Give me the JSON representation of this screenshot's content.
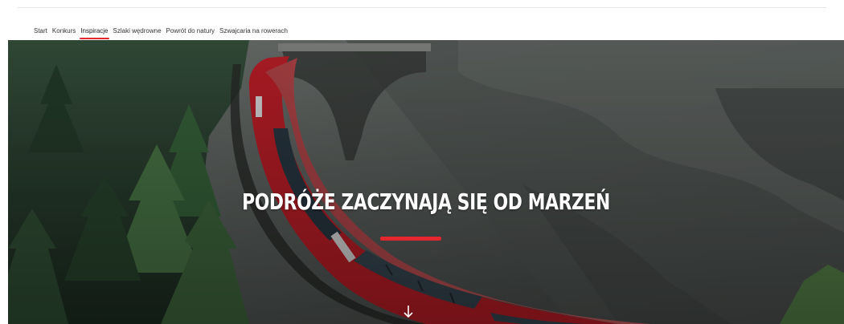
{
  "nav": {
    "items": [
      {
        "label": "Start",
        "active": false
      },
      {
        "label": "Konkurs",
        "active": false
      },
      {
        "label": "Inspiracje",
        "active": true
      },
      {
        "label": "Szlaki wędrowne",
        "active": false
      },
      {
        "label": "Powrót do natury",
        "active": false
      },
      {
        "label": "Szwajcaria na rowerach",
        "active": false
      }
    ]
  },
  "hero": {
    "title": "PODRÓŻE ZACZYNAJĄ SIĘ OD MARZEŃ",
    "scroll_icon": "arrow-down-icon"
  },
  "colors": {
    "accent": "#e4262f",
    "train_red": "#c8202a",
    "rock": "#6e7370",
    "forest": "#2f4634"
  }
}
